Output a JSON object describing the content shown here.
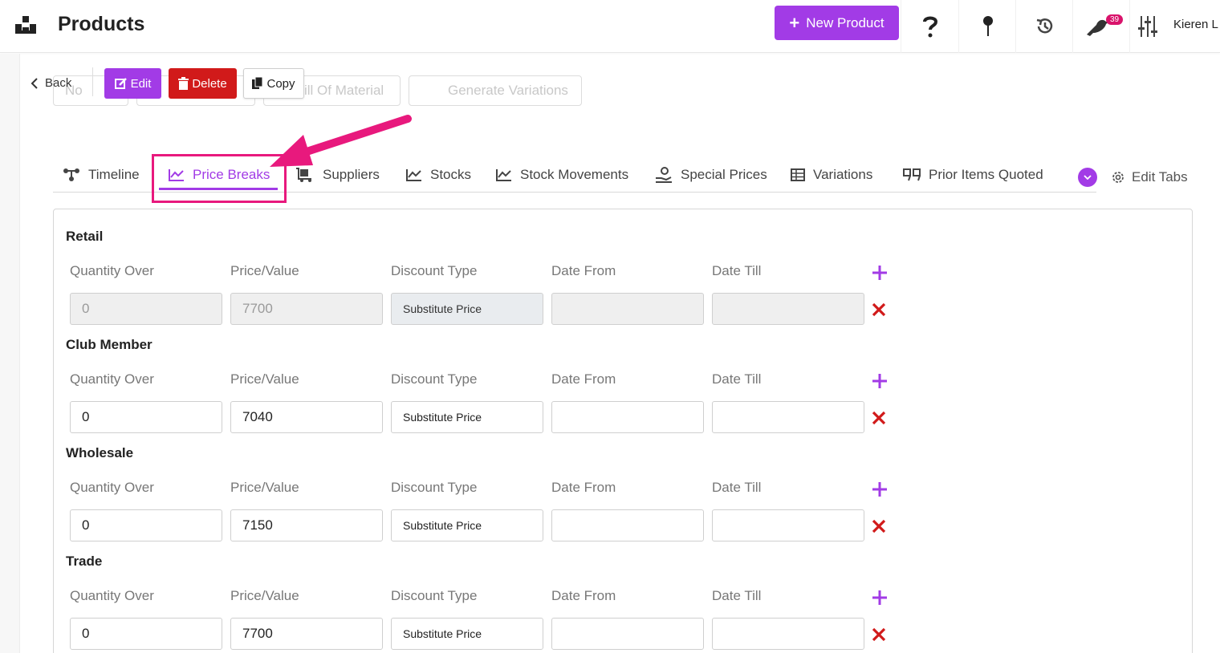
{
  "header": {
    "title": "Products",
    "new_product_label": "New Product",
    "notification_count": "39",
    "user_name": "Kieren L",
    "brand_color": "#a23be6"
  },
  "background_actions": [
    "No",
    "ill Of Material",
    "Generate Variations"
  ],
  "toolbar": {
    "back_label": "Back",
    "edit_label": "Edit",
    "delete_label": "Delete",
    "copy_label": "Copy"
  },
  "tabs": [
    {
      "label": "Timeline",
      "icon": "timeline-icon"
    },
    {
      "label": "Price Breaks",
      "icon": "chart-line-icon",
      "active": true
    },
    {
      "label": "Suppliers",
      "icon": "supplier-icon"
    },
    {
      "label": "Stocks",
      "icon": "chart-line-icon"
    },
    {
      "label": "Stock Movements",
      "icon": "chart-line-icon"
    },
    {
      "label": "Special Prices",
      "icon": "hand-coin-icon"
    },
    {
      "label": "Variations",
      "icon": "table-icon"
    },
    {
      "label": "Prior Items Quoted",
      "icon": "quote-icon"
    }
  ],
  "edit_tabs_label": "Edit Tabs",
  "columns": [
    "Quantity Over",
    "Price/Value",
    "Discount Type",
    "Date From",
    "Date Till"
  ],
  "price_groups": [
    {
      "name": "Retail",
      "quantity_over": "0",
      "price": "7700",
      "discount_type": "Substitute Price",
      "date_from": "",
      "date_till": "",
      "disabled": true
    },
    {
      "name": "Club Member",
      "quantity_over": "0",
      "price": "7040",
      "discount_type": "Substitute Price",
      "date_from": "",
      "date_till": "",
      "disabled": false
    },
    {
      "name": "Wholesale",
      "quantity_over": "0",
      "price": "7150",
      "discount_type": "Substitute Price",
      "date_from": "",
      "date_till": "",
      "disabled": false
    },
    {
      "name": "Trade",
      "quantity_over": "0",
      "price": "7700",
      "discount_type": "Substitute Price",
      "date_from": "",
      "date_till": "",
      "disabled": false
    }
  ],
  "colors": {
    "accent": "#a23be6",
    "danger": "#d11a1a",
    "annotation": "#e8197d"
  }
}
